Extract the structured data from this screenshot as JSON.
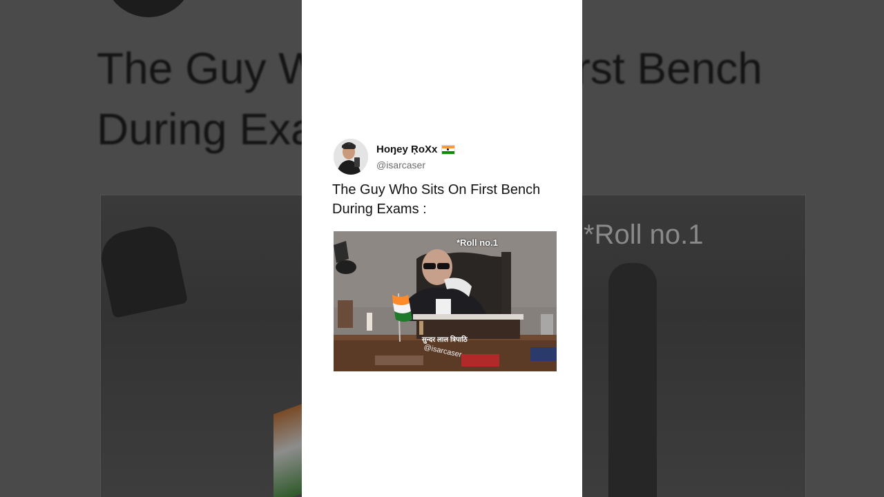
{
  "tweet": {
    "display_name": "Hoŋey ŖoXx",
    "handle": "@isarcaser",
    "text_line1": "The Guy Who Sits On First Bench",
    "text_line2": "During Exams :",
    "media": {
      "caption": "*Roll no.1",
      "nameplate": "सुन्दर लाल त्रिपाठि",
      "watermark": "@isarcaser"
    }
  },
  "background": {
    "text_line1": "The Guy Who Sits On First Bench",
    "text_line2": "During Exams :",
    "caption": "*Roll no.1"
  },
  "colors": {
    "frame": "#ffffff",
    "text": "#111111",
    "handle": "#6b6b6b",
    "backdrop": "#4a4a4a"
  }
}
